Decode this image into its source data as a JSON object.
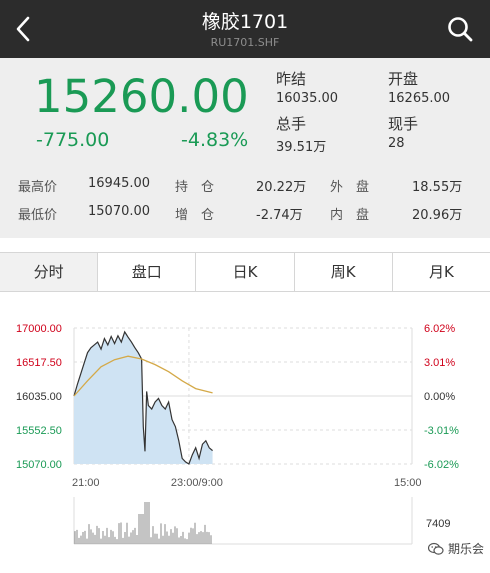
{
  "nav": {
    "title": "橡胶1701",
    "subtitle": "RU1701.SHF",
    "back_icon": "chevron-left-icon",
    "search_icon": "search-icon"
  },
  "quote": {
    "price": "15260.00",
    "change_abs": "-775.00",
    "change_pct": "-4.83%",
    "prev_close_label": "昨结",
    "prev_close_value": "16035.00",
    "open_label": "开盘",
    "open_value": "16265.00",
    "volume_label": "总手",
    "volume_value": "39.51万",
    "current_vol_label": "现手",
    "current_vol_value": "28",
    "color_down": "#1a9a55"
  },
  "stats": {
    "high_label": "最高价",
    "high_value": "16945.00",
    "low_label": "最低价",
    "low_value": "15070.00",
    "oi_label": "持　仓",
    "oi_value": "20.22万",
    "oi_change_label": "增　仓",
    "oi_change_value": "-2.74万",
    "outer_label": "外　盘",
    "outer_value": "18.55万",
    "inner_label": "内　盘",
    "inner_value": "20.96万"
  },
  "tabs": [
    "分时",
    "盘口",
    "日K",
    "周K",
    "月K"
  ],
  "active_tab": 0,
  "chart_data": {
    "type": "line",
    "y_ticks_left": [
      "17000.00",
      "16517.50",
      "16035.00",
      "15552.50",
      "15070.00"
    ],
    "y_ticks_right": [
      "6.02%",
      "3.01%",
      "0.00%",
      "-3.01%",
      "-6.02%"
    ],
    "y_tick_values": [
      17000,
      16517.5,
      16035,
      15552.5,
      15070
    ],
    "tick_colors": [
      "#d0021b",
      "#d0021b",
      "#333333",
      "#1a9a55",
      "#1a9a55"
    ],
    "ylim": [
      15070,
      17000
    ],
    "x_ticks": [
      "21:00",
      "23:00/9:00",
      "15:00"
    ],
    "session_length": 100,
    "x_tick_positions": [
      0,
      34,
      100
    ],
    "price_series": [
      [
        0,
        16035
      ],
      [
        1,
        16200
      ],
      [
        2,
        16350
      ],
      [
        3,
        16500
      ],
      [
        4,
        16650
      ],
      [
        5,
        16720
      ],
      [
        6,
        16760
      ],
      [
        7,
        16800
      ],
      [
        8,
        16700
      ],
      [
        9,
        16850
      ],
      [
        10,
        16760
      ],
      [
        11,
        16880
      ],
      [
        12,
        16780
      ],
      [
        13,
        16890
      ],
      [
        14,
        16800
      ],
      [
        15,
        16945
      ],
      [
        16,
        16870
      ],
      [
        17,
        16800
      ],
      [
        18,
        16720
      ],
      [
        19,
        16650
      ],
      [
        20,
        16560
      ],
      [
        20.5,
        15600
      ],
      [
        21,
        15250
      ],
      [
        21.5,
        16100
      ],
      [
        22,
        15900
      ],
      [
        23,
        15850
      ],
      [
        24,
        15950
      ],
      [
        25,
        16000
      ],
      [
        26,
        15900
      ],
      [
        27,
        15850
      ],
      [
        28,
        15950
      ],
      [
        29,
        15700
      ],
      [
        30,
        15600
      ],
      [
        31,
        15400
      ],
      [
        32,
        15150
      ],
      [
        33,
        15100
      ],
      [
        34,
        15070
      ],
      [
        35,
        15200
      ],
      [
        36,
        15300
      ],
      [
        37,
        15150
      ],
      [
        38,
        15350
      ],
      [
        39,
        15400
      ],
      [
        40,
        15300
      ],
      [
        41,
        15260
      ]
    ],
    "avg_series": [
      [
        0,
        16035
      ],
      [
        4,
        16250
      ],
      [
        8,
        16450
      ],
      [
        12,
        16550
      ],
      [
        16,
        16600
      ],
      [
        20,
        16560
      ],
      [
        24,
        16480
      ],
      [
        28,
        16380
      ],
      [
        32,
        16250
      ],
      [
        36,
        16140
      ],
      [
        41,
        16080
      ]
    ],
    "volume_value": "7409",
    "line_color": "#333333",
    "avg_color": "#d4a948",
    "fill_color": "#cfe3f3"
  },
  "watermark": {
    "icon": "wechat-icon",
    "text": "期乐会"
  }
}
